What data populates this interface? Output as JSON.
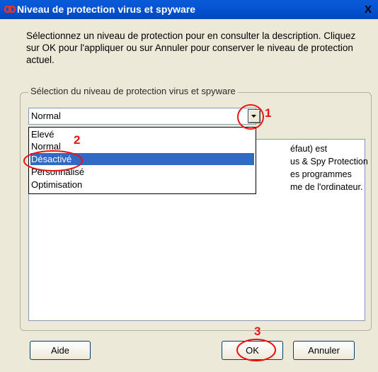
{
  "window": {
    "title": "Niveau de protection virus et spyware",
    "close_label": "X"
  },
  "description": "Sélectionnez un niveau de protection pour en consulter la description. Cliquez sur OK pour l'appliquer ou sur Annuler pour conserver le niveau de protection actuel.",
  "group": {
    "label": "Sélection du niveau de protection virus et spyware"
  },
  "combo": {
    "value": "Normal"
  },
  "dropdown": {
    "items": [
      "Elevé",
      "Normal",
      "Désactivé",
      "Personnalisé",
      "Optimisation"
    ],
    "selected_index": 2
  },
  "description_box": {
    "visible_fragments": [
      "éfaut) est",
      "us & Spy Protection",
      "es programmes",
      "me de l'ordinateur."
    ]
  },
  "buttons": {
    "help": "Aide",
    "ok": "OK",
    "cancel": "Annuler"
  },
  "annotations": [
    "1",
    "2",
    "3"
  ],
  "colors": {
    "annotation": "#ee1111",
    "selection": "#316ac5",
    "titlebar": "#0553d0"
  }
}
